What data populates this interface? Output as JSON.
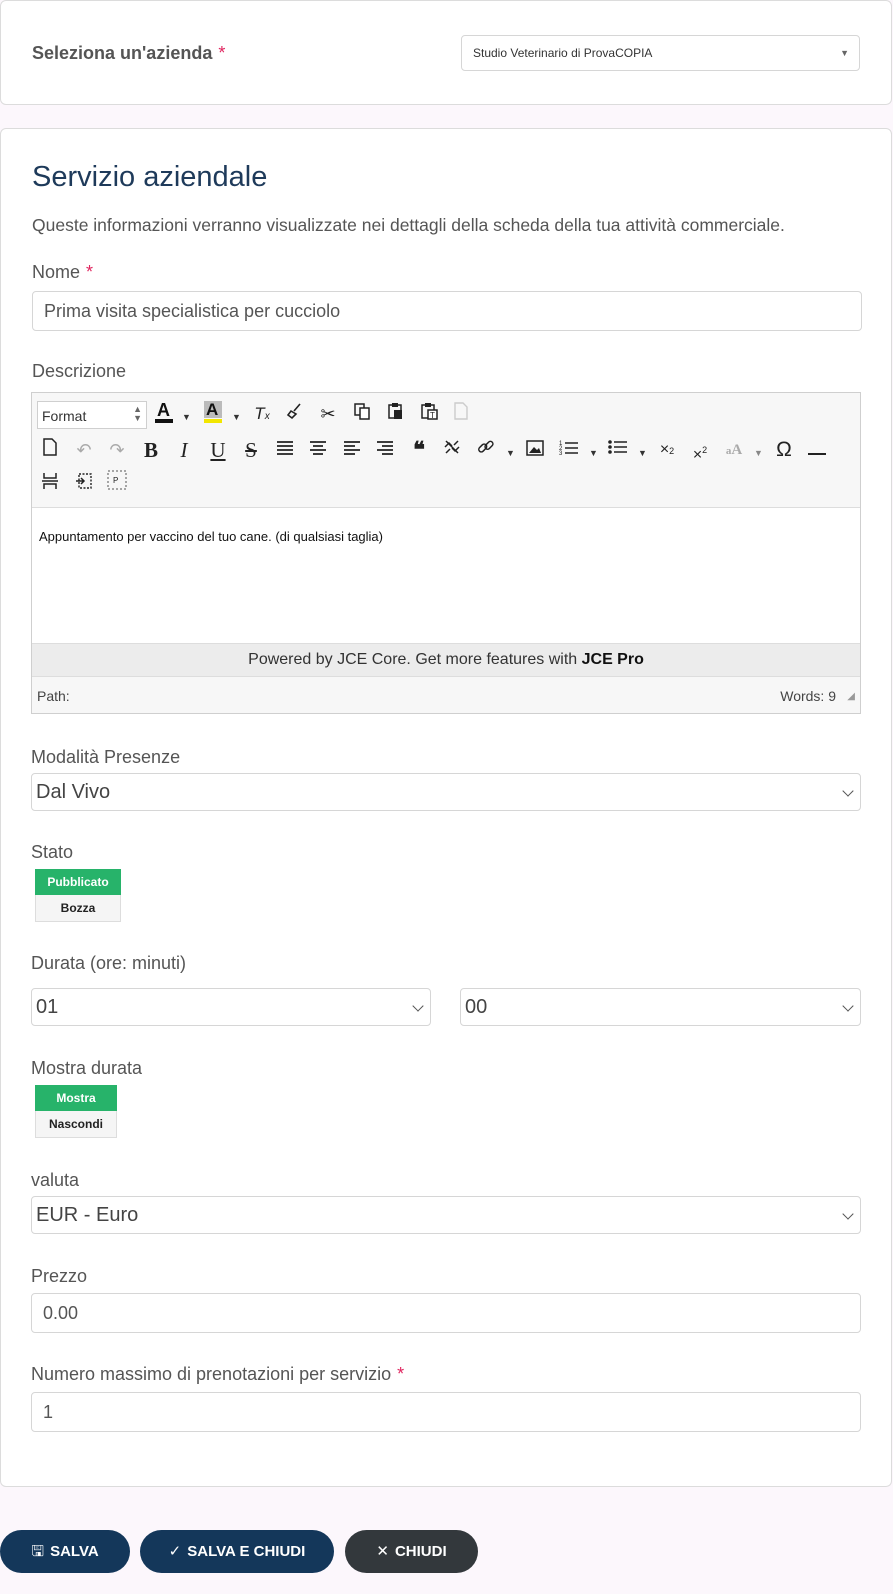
{
  "company": {
    "label": "Seleziona un'azienda",
    "required": "*",
    "selected": "Studio Veterinario di ProvaCOPIA"
  },
  "service": {
    "title": "Servizio aziendale",
    "subtitle": "Queste informazioni verranno visualizzate nei dettagli della scheda della tua attività commerciale.",
    "name_label": "Nome",
    "name_required": "*",
    "name_value": "Prima visita specialistica per cucciolo",
    "description_label": "Descrizione",
    "editor": {
      "format_label": "Format",
      "content": "Appuntamento per vaccino del tuo cane. (di qualsiasi taglia)",
      "powered_text": "Powered by JCE Core. Get more features with ",
      "powered_bold": "JCE Pro",
      "path_label": "Path:",
      "words_label": "Words: 9"
    },
    "attendance_label": "Modalità Presenze",
    "attendance_value": "Dal Vivo",
    "state_label": "Stato",
    "state_options": [
      "Pubblicato",
      "Bozza"
    ],
    "duration_label": "Durata (ore: minuti)",
    "duration_hours": "01",
    "duration_minutes": "00",
    "show_duration_label": "Mostra durata",
    "show_duration_options": [
      "Mostra",
      "Nascondi"
    ],
    "currency_label": "valuta",
    "currency_value": "EUR - Euro",
    "price_label": "Prezzo",
    "price_value": "0.00",
    "max_bookings_label": "Numero massimo di prenotazioni per servizio",
    "max_bookings_required": "*",
    "max_bookings_value": "1"
  },
  "actions": {
    "save": "SALVA",
    "save_close": "SALVA E CHIUDI",
    "close": "CHIUDI"
  },
  "colors": {
    "primary": "#14375a",
    "success": "#27b36a",
    "required": "#e0245e",
    "close_button": "#33383c"
  }
}
